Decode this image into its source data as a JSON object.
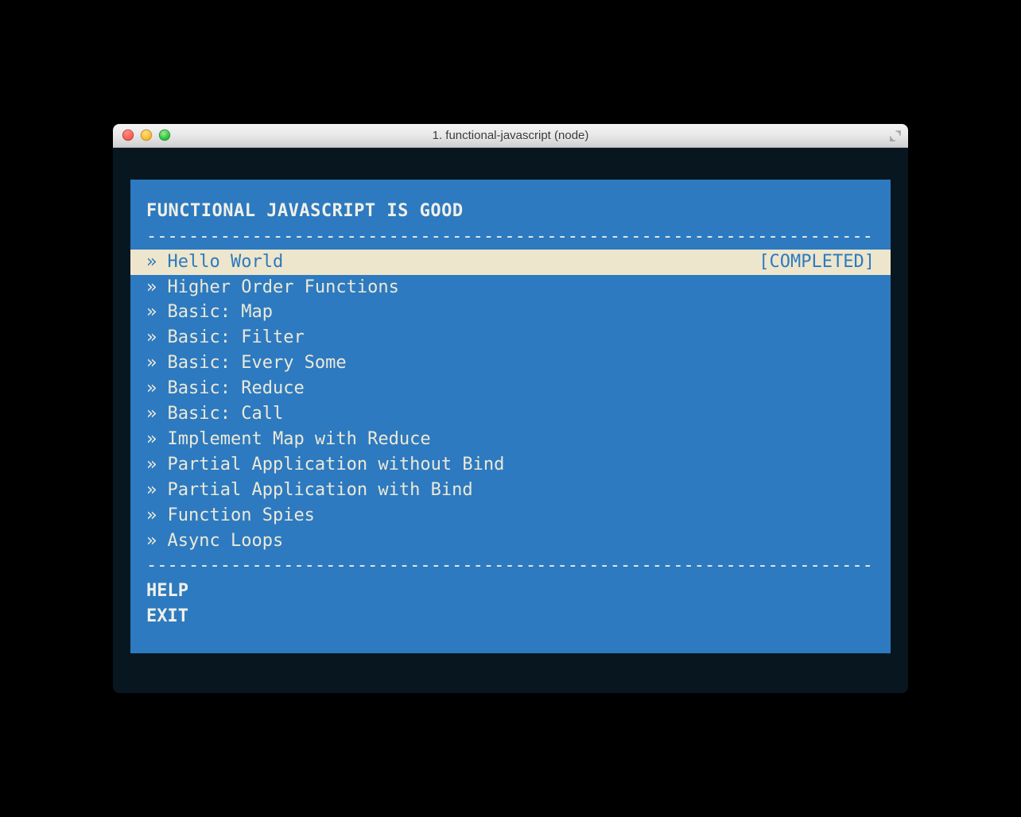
{
  "window": {
    "title": "1. functional-javascript (node)"
  },
  "panel": {
    "heading": "FUNCTIONAL JAVASCRIPT IS GOOD",
    "divider": "---------------------------------------------------------------------",
    "bullet": "»",
    "completed_tag": "[COMPLETED]",
    "items": [
      {
        "label": "Hello World",
        "selected": true,
        "completed": true
      },
      {
        "label": "Higher Order Functions",
        "selected": false,
        "completed": false
      },
      {
        "label": "Basic: Map",
        "selected": false,
        "completed": false
      },
      {
        "label": "Basic: Filter",
        "selected": false,
        "completed": false
      },
      {
        "label": "Basic: Every Some",
        "selected": false,
        "completed": false
      },
      {
        "label": "Basic: Reduce",
        "selected": false,
        "completed": false
      },
      {
        "label": "Basic: Call",
        "selected": false,
        "completed": false
      },
      {
        "label": "Implement Map with Reduce",
        "selected": false,
        "completed": false
      },
      {
        "label": "Partial Application without Bind",
        "selected": false,
        "completed": false
      },
      {
        "label": "Partial Application with Bind",
        "selected": false,
        "completed": false
      },
      {
        "label": "Function Spies",
        "selected": false,
        "completed": false
      },
      {
        "label": "Async Loops",
        "selected": false,
        "completed": false
      }
    ],
    "footer": {
      "help": "HELP",
      "exit": "EXIT"
    }
  }
}
